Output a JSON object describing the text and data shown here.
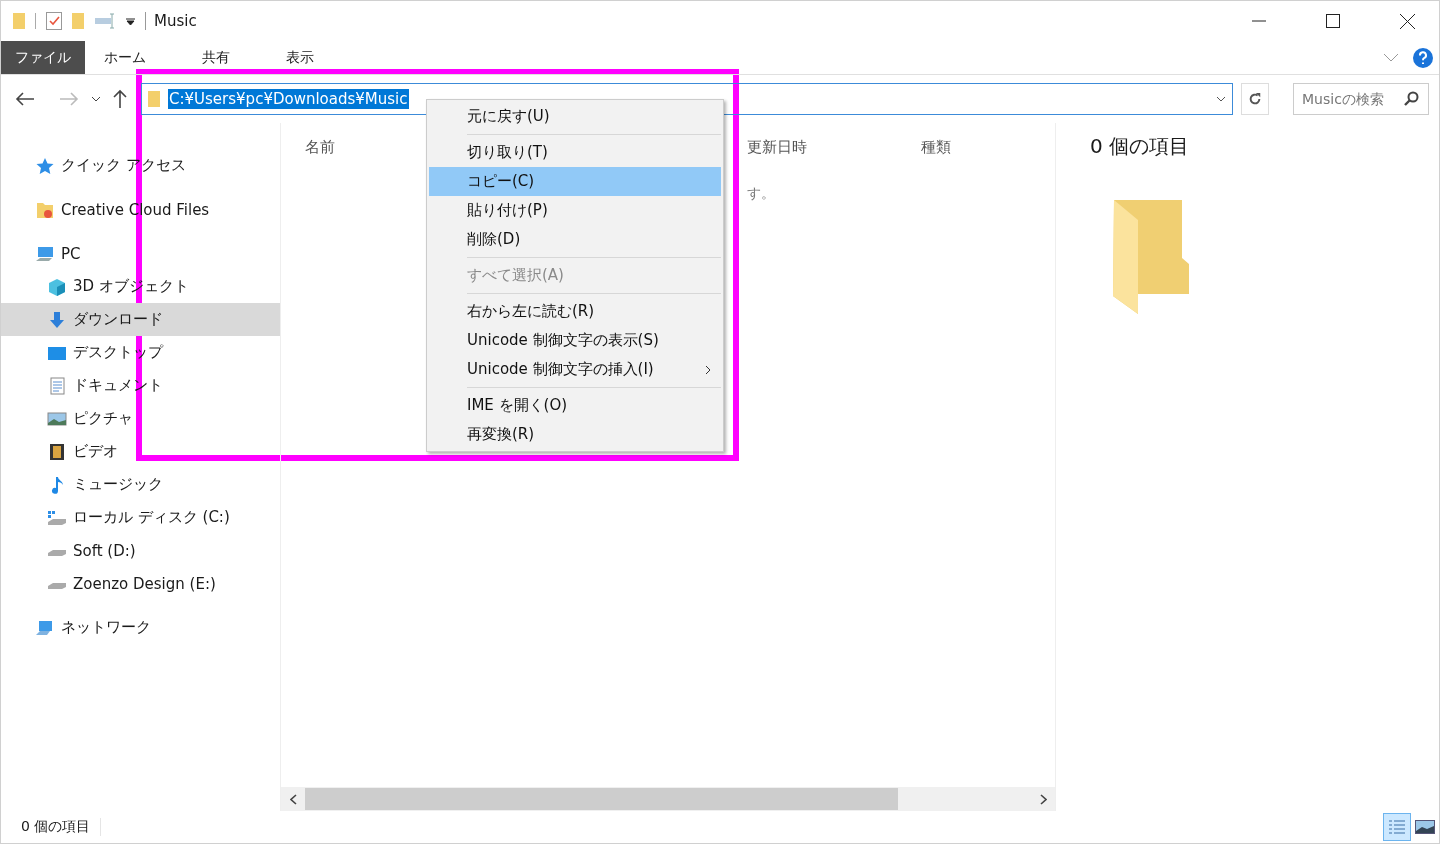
{
  "window": {
    "title": "Music"
  },
  "ribbon": {
    "tabs": [
      {
        "label": "ファイル",
        "kind": "file"
      },
      {
        "label": "ホーム",
        "kind": "tab"
      },
      {
        "label": "共有",
        "kind": "tab"
      },
      {
        "label": "表示",
        "kind": "tab"
      }
    ]
  },
  "address": {
    "value": "C:¥Users¥pc¥Downloads¥Music",
    "selected": true
  },
  "search": {
    "placeholder": "Musicの検索"
  },
  "sidebar": {
    "items": [
      {
        "label": "クイック アクセス",
        "kind": "star",
        "selected": false
      },
      {
        "label": "Creative Cloud Files",
        "kind": "cloud-folder",
        "selected": false
      },
      {
        "label": "PC",
        "kind": "pc",
        "selected": false,
        "children": [
          {
            "label": "3D オブジェクト",
            "kind": "cube",
            "selected": false
          },
          {
            "label": "ダウンロード",
            "kind": "download",
            "selected": true
          },
          {
            "label": "デスクトップ",
            "kind": "desktop",
            "selected": false
          },
          {
            "label": "ドキュメント",
            "kind": "document",
            "selected": false
          },
          {
            "label": "ピクチャ",
            "kind": "picture",
            "selected": false
          },
          {
            "label": "ビデオ",
            "kind": "video",
            "selected": false
          },
          {
            "label": "ミュージック",
            "kind": "music",
            "selected": false
          },
          {
            "label": "ローカル ディスク (C:)",
            "kind": "system-drive",
            "selected": false
          },
          {
            "label": "Soft (D:)",
            "kind": "drive",
            "selected": false
          },
          {
            "label": "Zoenzo Design (E:)",
            "kind": "drive",
            "selected": false
          }
        ]
      },
      {
        "label": "ネットワーク",
        "kind": "network",
        "selected": false
      }
    ]
  },
  "columns": [
    {
      "label": "名前"
    },
    {
      "label": "更新日時"
    },
    {
      "label": "種類"
    }
  ],
  "empty_message": "す。",
  "context_menu": {
    "items": [
      {
        "kind": "item",
        "label": "元に戻す(U)",
        "highlighted": false,
        "disabled": false
      },
      {
        "kind": "separator"
      },
      {
        "kind": "item",
        "label": "切り取り(T)",
        "highlighted": false,
        "disabled": false
      },
      {
        "kind": "item",
        "label": "コピー(C)",
        "highlighted": true,
        "disabled": false
      },
      {
        "kind": "item",
        "label": "貼り付け(P)",
        "highlighted": false,
        "disabled": false
      },
      {
        "kind": "item",
        "label": "削除(D)",
        "highlighted": false,
        "disabled": false
      },
      {
        "kind": "separator"
      },
      {
        "kind": "item",
        "label": "すべて選択(A)",
        "highlighted": false,
        "disabled": true
      },
      {
        "kind": "separator"
      },
      {
        "kind": "item",
        "label": "右から左に読む(R)",
        "highlighted": false,
        "disabled": false
      },
      {
        "kind": "item",
        "label": "Unicode 制御文字の表示(S)",
        "highlighted": false,
        "disabled": false
      },
      {
        "kind": "submenu",
        "label": "Unicode 制御文字の挿入(I)",
        "highlighted": false,
        "disabled": false
      },
      {
        "kind": "separator"
      },
      {
        "kind": "item",
        "label": "IME を開く(O)",
        "highlighted": false,
        "disabled": false
      },
      {
        "kind": "item",
        "label": "再変換(R)",
        "highlighted": false,
        "disabled": false
      }
    ]
  },
  "details": {
    "count": "0 個の項目"
  },
  "status_bar": {
    "count": "0 個の項目",
    "views": [
      {
        "kind": "details",
        "selected": true
      },
      {
        "kind": "large-icons",
        "selected": false
      }
    ]
  }
}
